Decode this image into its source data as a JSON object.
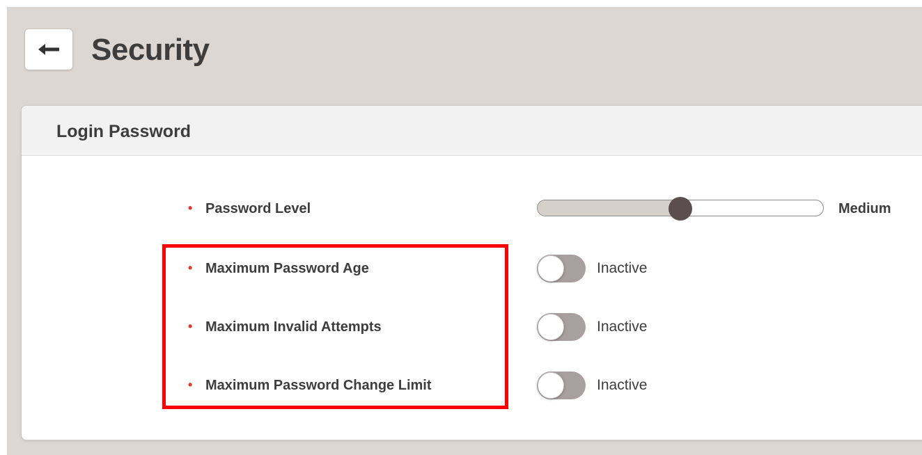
{
  "header": {
    "title": "Security",
    "back_icon": "arrow-left-icon"
  },
  "panel": {
    "title": "Login Password",
    "password_level": {
      "label": "Password Level",
      "value_label": "Medium",
      "level_fraction": 0.5,
      "accent_color": "#5c4d4f"
    },
    "settings": [
      {
        "label": "Maximum Password Age",
        "status": "Inactive",
        "enabled": false
      },
      {
        "label": "Maximum Invalid Attempts",
        "status": "Inactive",
        "enabled": false
      },
      {
        "label": "Maximum Password Change Limit",
        "status": "Inactive",
        "enabled": false
      }
    ]
  },
  "colors": {
    "required_marker": "#e5352b",
    "highlight": "#ff0000",
    "page_background": "#dcd7d3"
  }
}
